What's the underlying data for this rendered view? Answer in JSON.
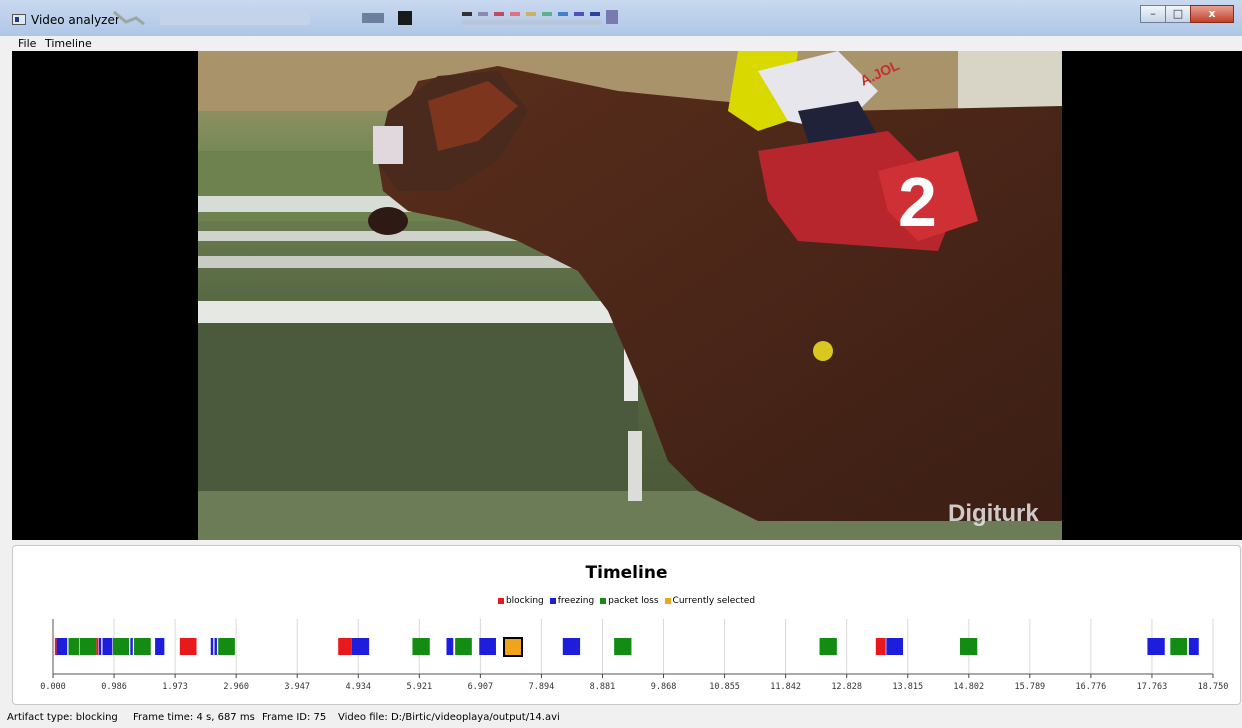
{
  "window": {
    "title": "Video analyzer",
    "minimize_symbol": "–",
    "maximize_symbol": "□",
    "close_symbol": "x"
  },
  "menu": [
    "File",
    "Timeline"
  ],
  "video": {
    "overlay_number": "2",
    "watermark": "Digiturk",
    "rider_text": "A.JOL"
  },
  "timeline": {
    "title": "Timeline",
    "legend": [
      {
        "label": "blocking",
        "color": "#e8191c"
      },
      {
        "label": "freezing",
        "color": "#1d1ddb"
      },
      {
        "label": "packet loss",
        "color": "#148c14"
      },
      {
        "label": "Currently selected",
        "color": "#f0a41c"
      }
    ],
    "x_min": 0,
    "x_max": 18.75,
    "tick_labels": [
      "0.000",
      "0.986",
      "1.973",
      "2.960",
      "3.947",
      "4.934",
      "5.921",
      "6.907",
      "7.894",
      "8.881",
      "9.868",
      "10.855",
      "11.842",
      "12.828",
      "13.815",
      "14.802",
      "15.789",
      "16.776",
      "17.763",
      "18.750"
    ],
    "selected_time": 7.29,
    "events": [
      {
        "type": "blocking",
        "t": 0.03,
        "w": 0.02
      },
      {
        "type": "freezing",
        "t": 0.06,
        "w": 0.17
      },
      {
        "type": "packet loss",
        "t": 0.25,
        "w": 0.17
      },
      {
        "type": "packet loss",
        "t": 0.43,
        "w": 0.27
      },
      {
        "type": "blocking",
        "t": 0.7,
        "w": 0.03
      },
      {
        "type": "freezing",
        "t": 0.74,
        "w": 0.04
      },
      {
        "type": "freezing",
        "t": 0.8,
        "w": 0.16
      },
      {
        "type": "packet loss",
        "t": 0.97,
        "w": 0.26
      },
      {
        "type": "freezing",
        "t": 1.25,
        "w": 0.04
      },
      {
        "type": "packet loss",
        "t": 1.31,
        "w": 0.27
      },
      {
        "type": "freezing",
        "t": 1.65,
        "w": 0.15
      },
      {
        "type": "blocking",
        "t": 2.05,
        "w": 0.27
      },
      {
        "type": "freezing",
        "t": 2.55,
        "w": 0.04
      },
      {
        "type": "freezing",
        "t": 2.61,
        "w": 0.04
      },
      {
        "type": "packet loss",
        "t": 2.67,
        "w": 0.27
      },
      {
        "type": "blocking",
        "t": 4.61,
        "w": 0.22
      },
      {
        "type": "freezing",
        "t": 4.83,
        "w": 0.28
      },
      {
        "type": "packet loss",
        "t": 5.81,
        "w": 0.28
      },
      {
        "type": "freezing",
        "t": 6.36,
        "w": 0.11
      },
      {
        "type": "packet loss",
        "t": 6.5,
        "w": 0.27
      },
      {
        "type": "freezing",
        "t": 6.89,
        "w": 0.27
      },
      {
        "type": "freezing",
        "t": 8.24,
        "w": 0.28
      },
      {
        "type": "packet loss",
        "t": 9.07,
        "w": 0.28
      },
      {
        "type": "packet loss",
        "t": 12.39,
        "w": 0.28
      },
      {
        "type": "blocking",
        "t": 13.3,
        "w": 0.16
      },
      {
        "type": "freezing",
        "t": 13.47,
        "w": 0.27
      },
      {
        "type": "packet loss",
        "t": 14.66,
        "w": 0.28
      },
      {
        "type": "freezing",
        "t": 17.69,
        "w": 0.28
      },
      {
        "type": "packet loss",
        "t": 18.06,
        "w": 0.27
      },
      {
        "type": "freezing",
        "t": 18.36,
        "w": 0.16
      }
    ]
  },
  "status": {
    "artifact_type": "Artifact type: blocking",
    "frame_time": "Frame time: 4 s, 687 ms",
    "frame_id": "Frame ID: 75",
    "video_file": "Video file: D:/Birtic/videoplaya/output/14.avi"
  }
}
